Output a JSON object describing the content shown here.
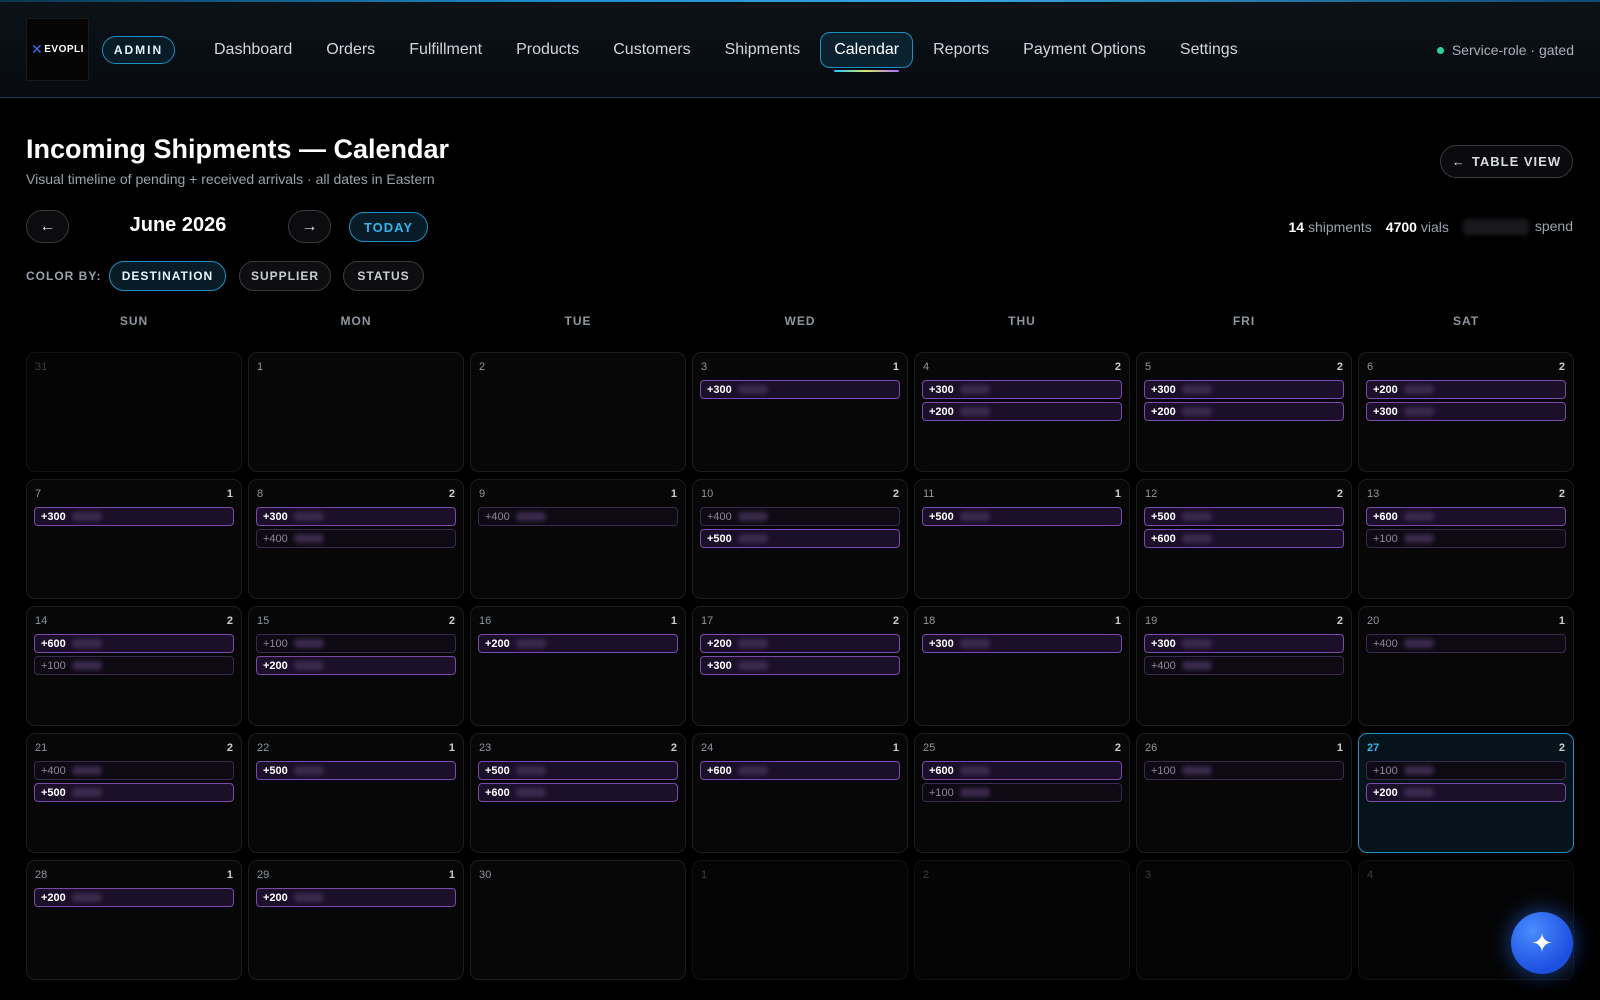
{
  "header": {
    "logo_text": "EVOPLI",
    "admin_badge": "ADMIN",
    "nav": [
      {
        "label": "Dashboard",
        "active": false
      },
      {
        "label": "Orders",
        "active": false
      },
      {
        "label": "Fulfillment",
        "active": false
      },
      {
        "label": "Products",
        "active": false
      },
      {
        "label": "Customers",
        "active": false
      },
      {
        "label": "Shipments",
        "active": false
      },
      {
        "label": "Calendar",
        "active": true
      },
      {
        "label": "Reports",
        "active": false
      },
      {
        "label": "Payment Options",
        "active": false
      },
      {
        "label": "Settings",
        "active": false
      }
    ],
    "service_status": "Service-role · gated",
    "status_color": "#2fd39a"
  },
  "page": {
    "title": "Incoming Shipments — Calendar",
    "subtitle": "Visual timeline of pending + received arrivals · all dates in Eastern",
    "table_view_label": "TABLE VIEW"
  },
  "controls": {
    "month_label": "June 2026",
    "today_label": "TODAY",
    "prev_icon": "arrow-left-icon",
    "next_icon": "arrow-right-icon"
  },
  "stats": {
    "shipments_count": "14",
    "shipments_label": "shipments",
    "vials_count": "4700",
    "vials_label": "vials",
    "spend_label": "spend"
  },
  "color_by": {
    "label": "COLOR BY:",
    "options": [
      {
        "label": "DESTINATION",
        "active": true
      },
      {
        "label": "SUPPLIER",
        "active": false
      },
      {
        "label": "STATUS",
        "active": false
      }
    ]
  },
  "weekdays": [
    "SUN",
    "MON",
    "TUE",
    "WED",
    "THU",
    "FRI",
    "SAT"
  ],
  "colors": {
    "accent": "#1e8fc0",
    "received_border": "#7a4aa8",
    "pending_border": "#3a2a4c",
    "fab": "#2a64f0"
  },
  "calendar": {
    "weeks": [
      [
        {
          "day": "31",
          "out": true,
          "count": "",
          "events": []
        },
        {
          "day": "1",
          "out": false,
          "count": "",
          "events": []
        },
        {
          "day": "2",
          "out": false,
          "count": "",
          "events": []
        },
        {
          "day": "3",
          "out": false,
          "count": "1",
          "events": [
            {
              "qty": "+300",
              "received": true
            }
          ]
        },
        {
          "day": "4",
          "out": false,
          "count": "2",
          "events": [
            {
              "qty": "+300",
              "received": true
            },
            {
              "qty": "+200",
              "received": true
            }
          ]
        },
        {
          "day": "5",
          "out": false,
          "count": "2",
          "events": [
            {
              "qty": "+300",
              "received": true
            },
            {
              "qty": "+200",
              "received": true
            }
          ]
        },
        {
          "day": "6",
          "out": false,
          "count": "2",
          "events": [
            {
              "qty": "+200",
              "received": true
            },
            {
              "qty": "+300",
              "received": true
            }
          ]
        }
      ],
      [
        {
          "day": "7",
          "out": false,
          "count": "1",
          "events": [
            {
              "qty": "+300",
              "received": true
            }
          ]
        },
        {
          "day": "8",
          "out": false,
          "count": "2",
          "events": [
            {
              "qty": "+300",
              "received": true
            },
            {
              "qty": "+400",
              "received": false
            }
          ]
        },
        {
          "day": "9",
          "out": false,
          "count": "1",
          "events": [
            {
              "qty": "+400",
              "received": false
            }
          ]
        },
        {
          "day": "10",
          "out": false,
          "count": "2",
          "events": [
            {
              "qty": "+400",
              "received": false
            },
            {
              "qty": "+500",
              "received": true
            }
          ]
        },
        {
          "day": "11",
          "out": false,
          "count": "1",
          "events": [
            {
              "qty": "+500",
              "received": true
            }
          ]
        },
        {
          "day": "12",
          "out": false,
          "count": "2",
          "events": [
            {
              "qty": "+500",
              "received": true
            },
            {
              "qty": "+600",
              "received": true
            }
          ]
        },
        {
          "day": "13",
          "out": false,
          "count": "2",
          "events": [
            {
              "qty": "+600",
              "received": true
            },
            {
              "qty": "+100",
              "received": false
            }
          ]
        }
      ],
      [
        {
          "day": "14",
          "out": false,
          "count": "2",
          "events": [
            {
              "qty": "+600",
              "received": true
            },
            {
              "qty": "+100",
              "received": false
            }
          ]
        },
        {
          "day": "15",
          "out": false,
          "count": "2",
          "events": [
            {
              "qty": "+100",
              "received": false
            },
            {
              "qty": "+200",
              "received": true
            }
          ]
        },
        {
          "day": "16",
          "out": false,
          "count": "1",
          "events": [
            {
              "qty": "+200",
              "received": true
            }
          ]
        },
        {
          "day": "17",
          "out": false,
          "count": "2",
          "events": [
            {
              "qty": "+200",
              "received": true
            },
            {
              "qty": "+300",
              "received": true
            }
          ]
        },
        {
          "day": "18",
          "out": false,
          "count": "1",
          "events": [
            {
              "qty": "+300",
              "received": true
            }
          ]
        },
        {
          "day": "19",
          "out": false,
          "count": "2",
          "events": [
            {
              "qty": "+300",
              "received": true
            },
            {
              "qty": "+400",
              "received": false
            }
          ]
        },
        {
          "day": "20",
          "out": false,
          "count": "1",
          "events": [
            {
              "qty": "+400",
              "received": false
            }
          ]
        }
      ],
      [
        {
          "day": "21",
          "out": false,
          "count": "2",
          "events": [
            {
              "qty": "+400",
              "received": false
            },
            {
              "qty": "+500",
              "received": true
            }
          ]
        },
        {
          "day": "22",
          "out": false,
          "count": "1",
          "events": [
            {
              "qty": "+500",
              "received": true
            }
          ]
        },
        {
          "day": "23",
          "out": false,
          "count": "2",
          "events": [
            {
              "qty": "+500",
              "received": true
            },
            {
              "qty": "+600",
              "received": true
            }
          ]
        },
        {
          "day": "24",
          "out": false,
          "count": "1",
          "events": [
            {
              "qty": "+600",
              "received": true
            }
          ]
        },
        {
          "day": "25",
          "out": false,
          "count": "2",
          "events": [
            {
              "qty": "+600",
              "received": true
            },
            {
              "qty": "+100",
              "received": false
            }
          ]
        },
        {
          "day": "26",
          "out": false,
          "count": "1",
          "events": [
            {
              "qty": "+100",
              "received": false
            }
          ]
        },
        {
          "day": "27",
          "out": false,
          "today": true,
          "count": "2",
          "events": [
            {
              "qty": "+100",
              "received": false
            },
            {
              "qty": "+200",
              "received": true
            }
          ]
        }
      ],
      [
        {
          "day": "28",
          "out": false,
          "count": "1",
          "events": [
            {
              "qty": "+200",
              "received": true
            }
          ]
        },
        {
          "day": "29",
          "out": false,
          "count": "1",
          "events": [
            {
              "qty": "+200",
              "received": true
            }
          ]
        },
        {
          "day": "30",
          "out": false,
          "count": "",
          "events": []
        },
        {
          "day": "1",
          "out": true,
          "count": "",
          "events": []
        },
        {
          "day": "2",
          "out": true,
          "count": "",
          "events": []
        },
        {
          "day": "3",
          "out": true,
          "count": "",
          "events": []
        },
        {
          "day": "4",
          "out": true,
          "count": "",
          "events": []
        }
      ]
    ]
  },
  "assistant": {
    "icon": "sparkle-icon"
  }
}
